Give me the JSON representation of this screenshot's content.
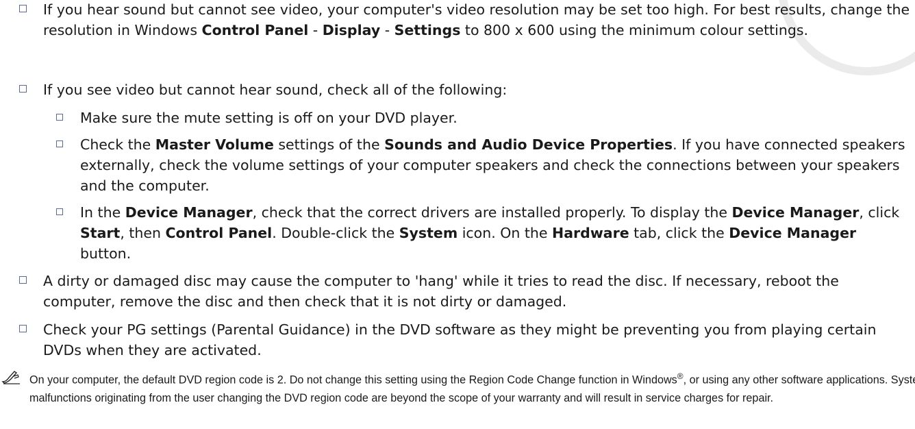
{
  "items": [
    {
      "text1": "If you hear sound but cannot see video, your computer's video resolution may be set too high. For best results, change the resolution in Windows ",
      "b1": "Control Panel",
      "t2": " - ",
      "b2": "Display",
      "t3": " - ",
      "b3": "Settings",
      "t4": " to 800 x 600 using the minimum colour settings."
    },
    {
      "text": "If you see video but cannot hear sound, check all of the following:"
    },
    {
      "text": "Make sure the mute setting is off on your DVD player."
    },
    {
      "t1": "Check the ",
      "b1": "Master Volume",
      "t2": " settings of the ",
      "b2": "Sounds and Audio Device Properties",
      "t3": ". If you have connected speakers externally, check the volume settings of your computer speakers and check the connections between your speakers and the computer."
    },
    {
      "t1": "In the ",
      "b1": "Device Manager",
      "t2": ", check that the correct drivers are installed properly. To display the ",
      "b2": "Device Manager",
      "t3": ", click ",
      "b3": "Start",
      "t4": ", then ",
      "b4": "Control Panel",
      "t5": ". Double-click the ",
      "b5": "System",
      "t6": " icon. On the ",
      "b6": "Hardware",
      "t7": " tab, click the ",
      "b7": "Device Manager",
      "t8": " button."
    },
    {
      "text": "A dirty or damaged disc may cause the computer to 'hang' while it tries to read the disc. If necessary, reboot the computer, remove the disc and then check that it is not dirty or damaged."
    },
    {
      "text": "Check your PG settings (Parental Guidance) in the DVD software as they might be preventing you from playing certain DVDs when they are activated."
    }
  ],
  "note": {
    "t1": "On your computer, the default DVD region code is 2. Do not change this setting using the Region Code Change function in Windows",
    "reg": "®",
    "t2": ", or using any other software applications. System malfunctions originating from the user changing the DVD region code are beyond the scope of your warranty and will result in service charges for repair."
  },
  "icons": {
    "bullet": "checkbox-square-icon",
    "note": "writing-hand-icon"
  }
}
